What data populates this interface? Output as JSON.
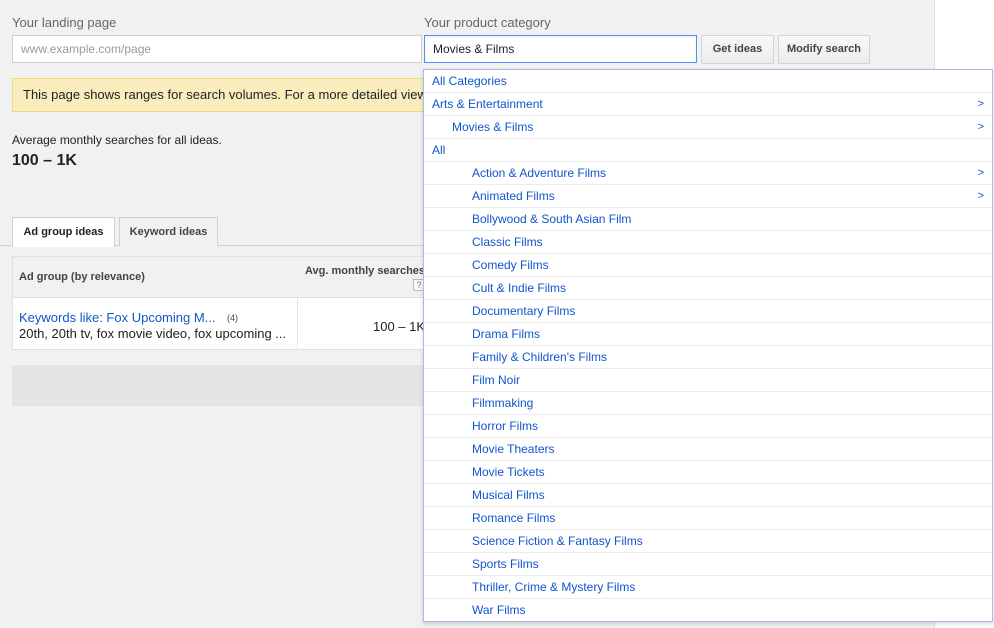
{
  "landing": {
    "label": "Your landing page",
    "placeholder": "www.example.com/page"
  },
  "category": {
    "label": "Your product category",
    "value": "Movies & Films"
  },
  "buttons": {
    "get_ideas": "Get ideas",
    "modify_search": "Modify search"
  },
  "notice": {
    "text": "This page shows ranges for search volumes. For a more detailed view"
  },
  "summary": {
    "label": "Average monthly searches for all ideas.",
    "value": "100 – 1K"
  },
  "tabs": [
    {
      "label": "Ad group ideas",
      "active": true
    },
    {
      "label": "Keyword ideas",
      "active": false
    }
  ],
  "table": {
    "headers": {
      "ad_group": "Ad group (by relevance)",
      "avg": "Avg. monthly searches",
      "help": "?"
    },
    "rows": [
      {
        "title": "Keywords like: Fox Upcoming M...",
        "count": "(4)",
        "keywords": "20th, 20th tv, fox movie video, fox upcoming ...",
        "avg": "100 – 1K"
      }
    ]
  },
  "dropdown": {
    "items": [
      {
        "label": "All Categories",
        "level": 0,
        "arrow": ""
      },
      {
        "label": "Arts & Entertainment",
        "level": 0,
        "arrow": ">"
      },
      {
        "label": "Movies & Films",
        "level": 1,
        "arrow": ">"
      },
      {
        "label": "All",
        "level": 0,
        "arrow": ""
      },
      {
        "label": "Action & Adventure Films",
        "level": 2,
        "arrow": ">"
      },
      {
        "label": "Animated Films",
        "level": 2,
        "arrow": ">"
      },
      {
        "label": "Bollywood & South Asian Film",
        "level": 2,
        "arrow": ""
      },
      {
        "label": "Classic Films",
        "level": 2,
        "arrow": ""
      },
      {
        "label": "Comedy Films",
        "level": 2,
        "arrow": ""
      },
      {
        "label": "Cult & Indie Films",
        "level": 2,
        "arrow": ""
      },
      {
        "label": "Documentary Films",
        "level": 2,
        "arrow": ""
      },
      {
        "label": "Drama Films",
        "level": 2,
        "arrow": ""
      },
      {
        "label": "Family & Children's Films",
        "level": 2,
        "arrow": ""
      },
      {
        "label": "Film Noir",
        "level": 2,
        "arrow": ""
      },
      {
        "label": "Filmmaking",
        "level": 2,
        "arrow": ""
      },
      {
        "label": "Horror Films",
        "level": 2,
        "arrow": ""
      },
      {
        "label": "Movie Theaters",
        "level": 2,
        "arrow": ""
      },
      {
        "label": "Movie Tickets",
        "level": 2,
        "arrow": ""
      },
      {
        "label": "Musical Films",
        "level": 2,
        "arrow": ""
      },
      {
        "label": "Romance Films",
        "level": 2,
        "arrow": ""
      },
      {
        "label": "Science Fiction & Fantasy Films",
        "level": 2,
        "arrow": ""
      },
      {
        "label": "Sports Films",
        "level": 2,
        "arrow": ""
      },
      {
        "label": "Thriller, Crime & Mystery Films",
        "level": 2,
        "arrow": ""
      },
      {
        "label": "War Films",
        "level": 2,
        "arrow": ""
      }
    ]
  }
}
